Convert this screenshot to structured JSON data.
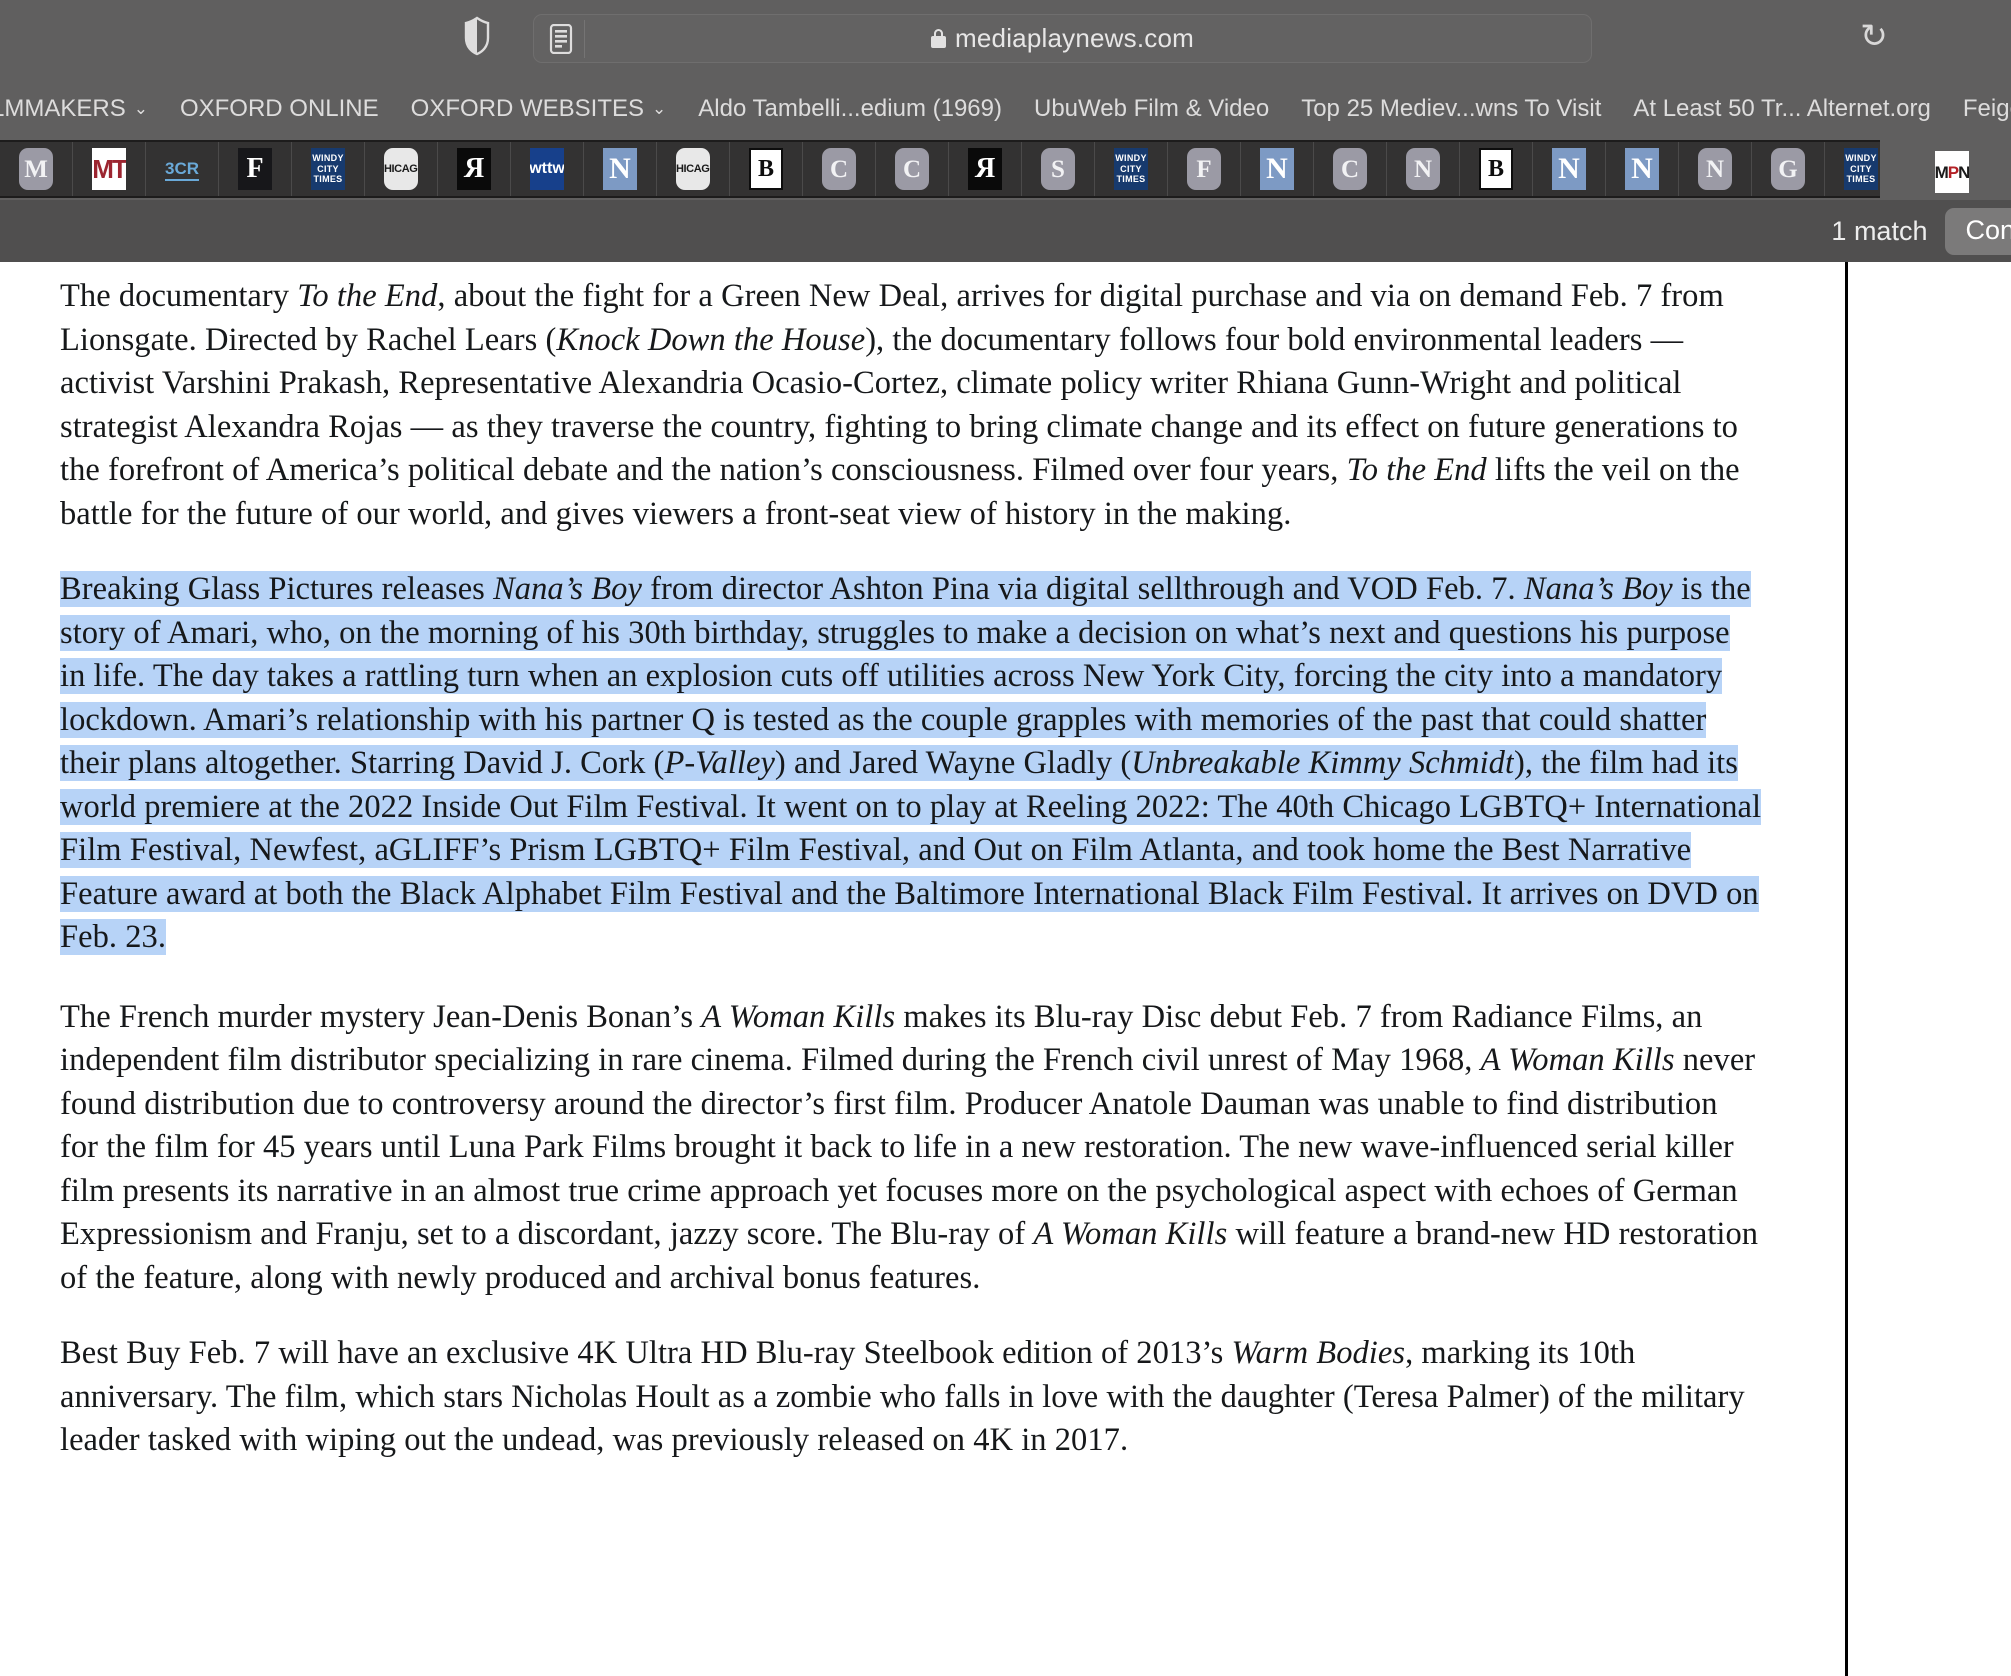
{
  "browser": {
    "url": "mediaplaynews.com",
    "lock_icon": "lock-icon",
    "shield_icon": "shield-icon",
    "reader_icon": "reader-view-icon",
    "reload_icon": "reload-icon",
    "reload_glyph": "↻"
  },
  "bookmarks": [
    {
      "label": "LMMAKERS",
      "caret": "⌄"
    },
    {
      "label": "OXFORD ONLINE",
      "caret": ""
    },
    {
      "label": "OXFORD WEBSITES",
      "caret": "⌄"
    },
    {
      "label": "Aldo Tambelli...edium (1969)",
      "caret": ""
    },
    {
      "label": "UbuWeb Film & Video",
      "caret": ""
    },
    {
      "label": "Top 25 Mediev...wns To Visit",
      "caret": ""
    },
    {
      "label": "At Least 50 Tr... Alternet.org",
      "caret": ""
    },
    {
      "label": "Feigenbaum",
      "caret": ""
    }
  ],
  "favicons": [
    {
      "name": "favicon-m",
      "style": "grey-round",
      "text": "M"
    },
    {
      "name": "favicon-mt",
      "style": "mt",
      "text": "MT"
    },
    {
      "name": "favicon-3cr",
      "style": "cr3",
      "text": "3CR"
    },
    {
      "name": "favicon-f-black",
      "style": "black-box",
      "text": "F"
    },
    {
      "name": "favicon-windy-city-times-1",
      "style": "wct",
      "text": "WINDY|CITY|TIMES"
    },
    {
      "name": "favicon-chicago-1",
      "style": "chicago",
      "text": "cHICAGo"
    },
    {
      "name": "favicon-r-reversed-1",
      "style": "rev-r",
      "text": "R"
    },
    {
      "name": "favicon-wttw",
      "style": "wttw",
      "text": "wttw"
    },
    {
      "name": "favicon-n-blue-1",
      "style": "netflix-n",
      "text": "N"
    },
    {
      "name": "favicon-chicago-2",
      "style": "chicago",
      "text": "cHICAGo"
    },
    {
      "name": "favicon-b-white-1",
      "style": "white-box",
      "text": "B"
    },
    {
      "name": "favicon-c-grey-1",
      "style": "grey-round",
      "text": "C"
    },
    {
      "name": "favicon-c-grey-2",
      "style": "grey-round",
      "text": "C"
    },
    {
      "name": "favicon-r-reversed-2",
      "style": "rev-r",
      "text": "R"
    },
    {
      "name": "favicon-s-grey",
      "style": "grey-round",
      "text": "S"
    },
    {
      "name": "favicon-windy-city-times-2",
      "style": "wct",
      "text": "WINDY|CITY|TIMES"
    },
    {
      "name": "favicon-f-grey",
      "style": "grey-round",
      "text": "F"
    },
    {
      "name": "favicon-n-blue-2",
      "style": "netflix-n",
      "text": "N"
    },
    {
      "name": "favicon-c-grey-3",
      "style": "grey-round",
      "text": "C"
    },
    {
      "name": "favicon-n-grey-1",
      "style": "grey-round",
      "text": "N"
    },
    {
      "name": "favicon-b-white-2",
      "style": "white-box",
      "text": "B"
    },
    {
      "name": "favicon-n-blue-3",
      "style": "netflix-n",
      "text": "N"
    },
    {
      "name": "favicon-n-blue-4",
      "style": "netflix-n",
      "text": "N"
    },
    {
      "name": "favicon-n-grey-2",
      "style": "grey-round",
      "text": "N"
    },
    {
      "name": "favicon-g-grey",
      "style": "grey-round",
      "text": "G"
    },
    {
      "name": "favicon-windy-city-times-3",
      "style": "wct",
      "text": "WINDY|CITY|TIMES"
    },
    {
      "name": "favicon-mpn-1",
      "style": "mpn",
      "text": "MPN"
    }
  ],
  "favicon_tail": {
    "name": "favicon-mpn-2",
    "style": "mpn",
    "text": "MPN"
  },
  "find_bar": {
    "match_count": "1 match",
    "continue_label": "Con"
  },
  "article": {
    "paragraphs": [
      {
        "id": "paragraph-to-the-end",
        "highlighted": false,
        "runs": [
          {
            "t": "The documentary "
          },
          {
            "t": "To the End",
            "i": true
          },
          {
            "t": ", about the fight for a Green New Deal, arrives for digital purchase and via on demand Feb. 7 from Lionsgate. Directed by Rachel Lears ("
          },
          {
            "t": "Knock Down the House",
            "i": true
          },
          {
            "t": "), the documentary follows four bold environmental leaders — activist Varshini Prakash, Representative Alexandria Ocasio-Cortez, climate policy writer Rhiana Gunn-Wright and political strategist Alexandra Rojas — as they traverse the country, fighting to bring climate change and its effect on future generations to the forefront of America’s political debate and the nation’s consciousness. Filmed over four years, "
          },
          {
            "t": "To the End",
            "i": true
          },
          {
            "t": " lifts the veil on the battle for the future of our world, and gives viewers a front-seat view of history in the making."
          }
        ]
      },
      {
        "id": "paragraph-nanas-boy",
        "highlighted": true,
        "runs": [
          {
            "t": "Breaking Glass Pictures releases "
          },
          {
            "t": "Nana’s Boy",
            "i": true
          },
          {
            "t": " from director Ashton Pina via digital sellthrough and VOD Feb. 7. "
          },
          {
            "t": "Nana’s Boy",
            "i": true
          },
          {
            "t": " is the story of Amari, who, on the morning of his 30th birthday, struggles to make a decision on what’s next and questions his purpose in life. The day takes a rattling turn when an explosion cuts off utilities across New York City, forcing the city into a mandatory lockdown. Amari’s relationship with his partner Q is tested as the couple grapples with memories of the past that could shatter their plans altogether. Starring David J. Cork ("
          },
          {
            "t": "P-Valley",
            "i": true
          },
          {
            "t": ") and Jared Wayne Gladly ("
          },
          {
            "t": "Unbreakable Kimmy Schmidt",
            "i": true
          },
          {
            "t": "), the film had its world premiere at the 2022 Inside Out Film Festival. It went on to play at Reeling 2022: The 40th Chicago LGBTQ+ International Film Festival, Newfest, aGLIFF’s Prism LGBTQ+ Film Festival, and Out on Film Atlanta, and took home the Best Narrative Feature award at both the Black Alphabet Film Festival and the Baltimore International Black Film Festival. It arrives on DVD on Feb. 23."
          }
        ]
      },
      {
        "id": "paragraph-a-woman-kills",
        "highlighted": false,
        "runs": [
          {
            "t": "The French murder mystery Jean-Denis Bonan’s "
          },
          {
            "t": "A Woman Kills",
            "i": true
          },
          {
            "t": " makes its Blu-ray Disc debut Feb. 7 from Radiance Films, an independent film distributor specializing in rare cinema. Filmed during the French civil unrest of May 1968, "
          },
          {
            "t": "A Woman Kills",
            "i": true
          },
          {
            "t": " never found distribution due to controversy around the director’s first film.  Producer Anatole Dauman was unable to find distribution for the film for 45 years until Luna Park Films brought it back to life in a new restoration. The new wave-influenced serial killer film presents its narrative in an almost true crime approach yet focuses more on the psychological aspect with echoes of German Expressionism and Franju, set to a discordant, jazzy score. The Blu-ray of "
          },
          {
            "t": "A Woman Kills",
            "i": true
          },
          {
            "t": " will feature a brand-new HD restoration of the feature, along with newly produced and archival bonus features."
          }
        ]
      },
      {
        "id": "paragraph-warm-bodies",
        "highlighted": false,
        "runs": [
          {
            "t": "Best Buy Feb. 7 will have an exclusive 4K Ultra HD Blu-ray Steelbook edition of 2013’s "
          },
          {
            "t": "Warm Bodies",
            "i": true
          },
          {
            "t": ", marking its 10th anniversary. The film, which stars Nicholas Hoult as a zombie who falls in love with the daughter (Teresa Palmer) of the military leader tasked with wiping out the undead, was previously released on 4K in 2017."
          }
        ]
      }
    ]
  },
  "colors": {
    "chrome_bg": "#605f5f",
    "favicon_bar_bg": "#333232",
    "find_bar_bg": "#504f4f",
    "highlight": "#b7d3f7",
    "page_bg": "#ffffff",
    "text": "#16181a"
  }
}
